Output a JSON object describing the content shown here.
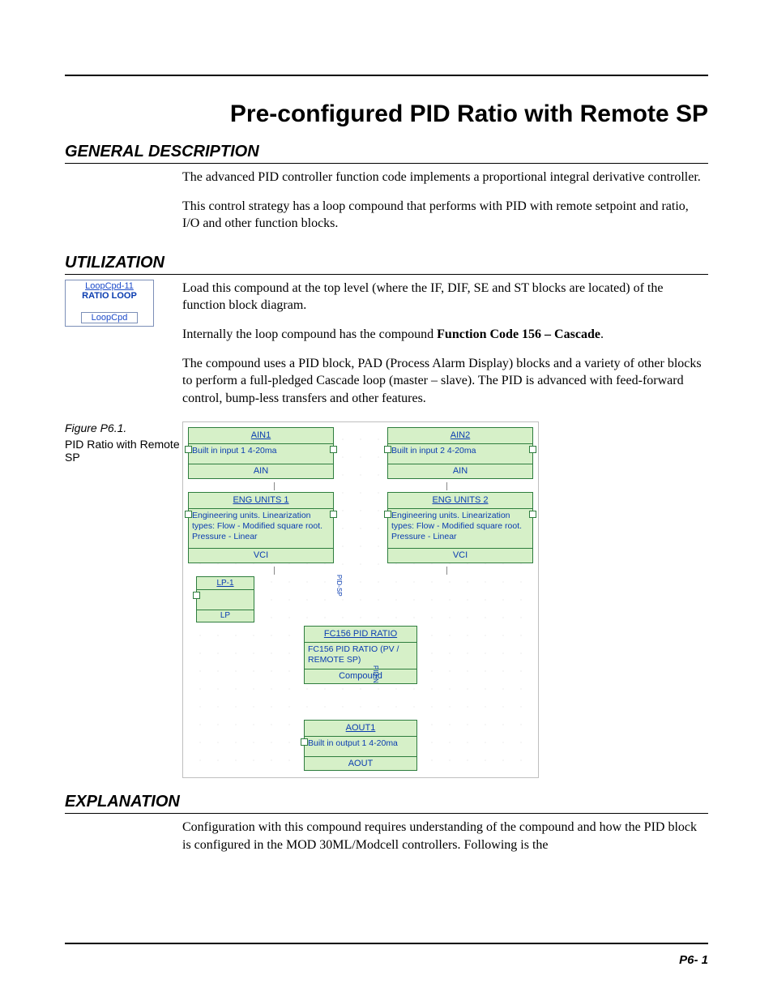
{
  "title": "Pre-configured PID Ratio with Remote SP",
  "sections": {
    "general": {
      "heading": "GENERAL DESCRIPTION",
      "p1": "The advanced PID controller function code implements a proportional integral derivative controller.",
      "p2": "This control strategy has a loop compound that performs with PID with remote setpoint and ratio, I/O and other function blocks."
    },
    "utilization": {
      "heading": "UTILIZATION",
      "icon": {
        "line1": "LoopCpd-11",
        "line2": "RATIO LOOP",
        "bottom": "LoopCpd"
      },
      "p1": "Load this compound at the top level (where the IF, DIF, SE and ST blocks are located) of the function block diagram.",
      "p2_pre": "Internally the loop compound has the compound ",
      "p2_bold": "Function Code 156 – Cascade",
      "p2_post": ".",
      "p3": "The compound uses a PID block, PAD (Process Alarm Display) blocks and a variety of other blocks to perform a full-pledged Cascade loop (master – slave). The PID is advanced with feed-forward control, bump-less transfers and other features."
    },
    "figure": {
      "label": "Figure P6.1.",
      "caption": "PID Ratio with Remote SP",
      "blocks": {
        "ain1": {
          "head": "AIN1",
          "body": "Built in input 1  4-20ma",
          "foot": "AIN"
        },
        "ain2": {
          "head": "AIN2",
          "body": "Built in input 2  4-20ma",
          "foot": "AIN"
        },
        "eng1": {
          "head": "ENG UNITS 1",
          "body": "Engineering units. Linearization types: Flow - Modified square root. Pressure - Linear",
          "foot": "VCI"
        },
        "eng2": {
          "head": "ENG UNITS 2",
          "body": "Engineering units. Linearization types: Flow - Modified square root. Pressure - Linear",
          "foot": "VCI"
        },
        "lp1": {
          "head": "LP-1",
          "body": "",
          "foot": "LP"
        },
        "pid": {
          "head": "FC156 PID RATIO",
          "body": "FC156 PID RATIO (PV / REMOTE SP)",
          "foot": "Compound"
        },
        "aout": {
          "head": "AOUT1",
          "body": "Built in output 1 4-20ma",
          "foot": "AOUT"
        }
      },
      "tags": {
        "t1": "PID-SP",
        "t2": "PID-N"
      }
    },
    "explanation": {
      "heading": "EXPLANATION",
      "p1": "Configuration with this compound requires understanding of the compound and how the PID block is configured in the MOD 30ML/Modcell controllers. Following is the"
    }
  },
  "page_number": "P6- 1"
}
